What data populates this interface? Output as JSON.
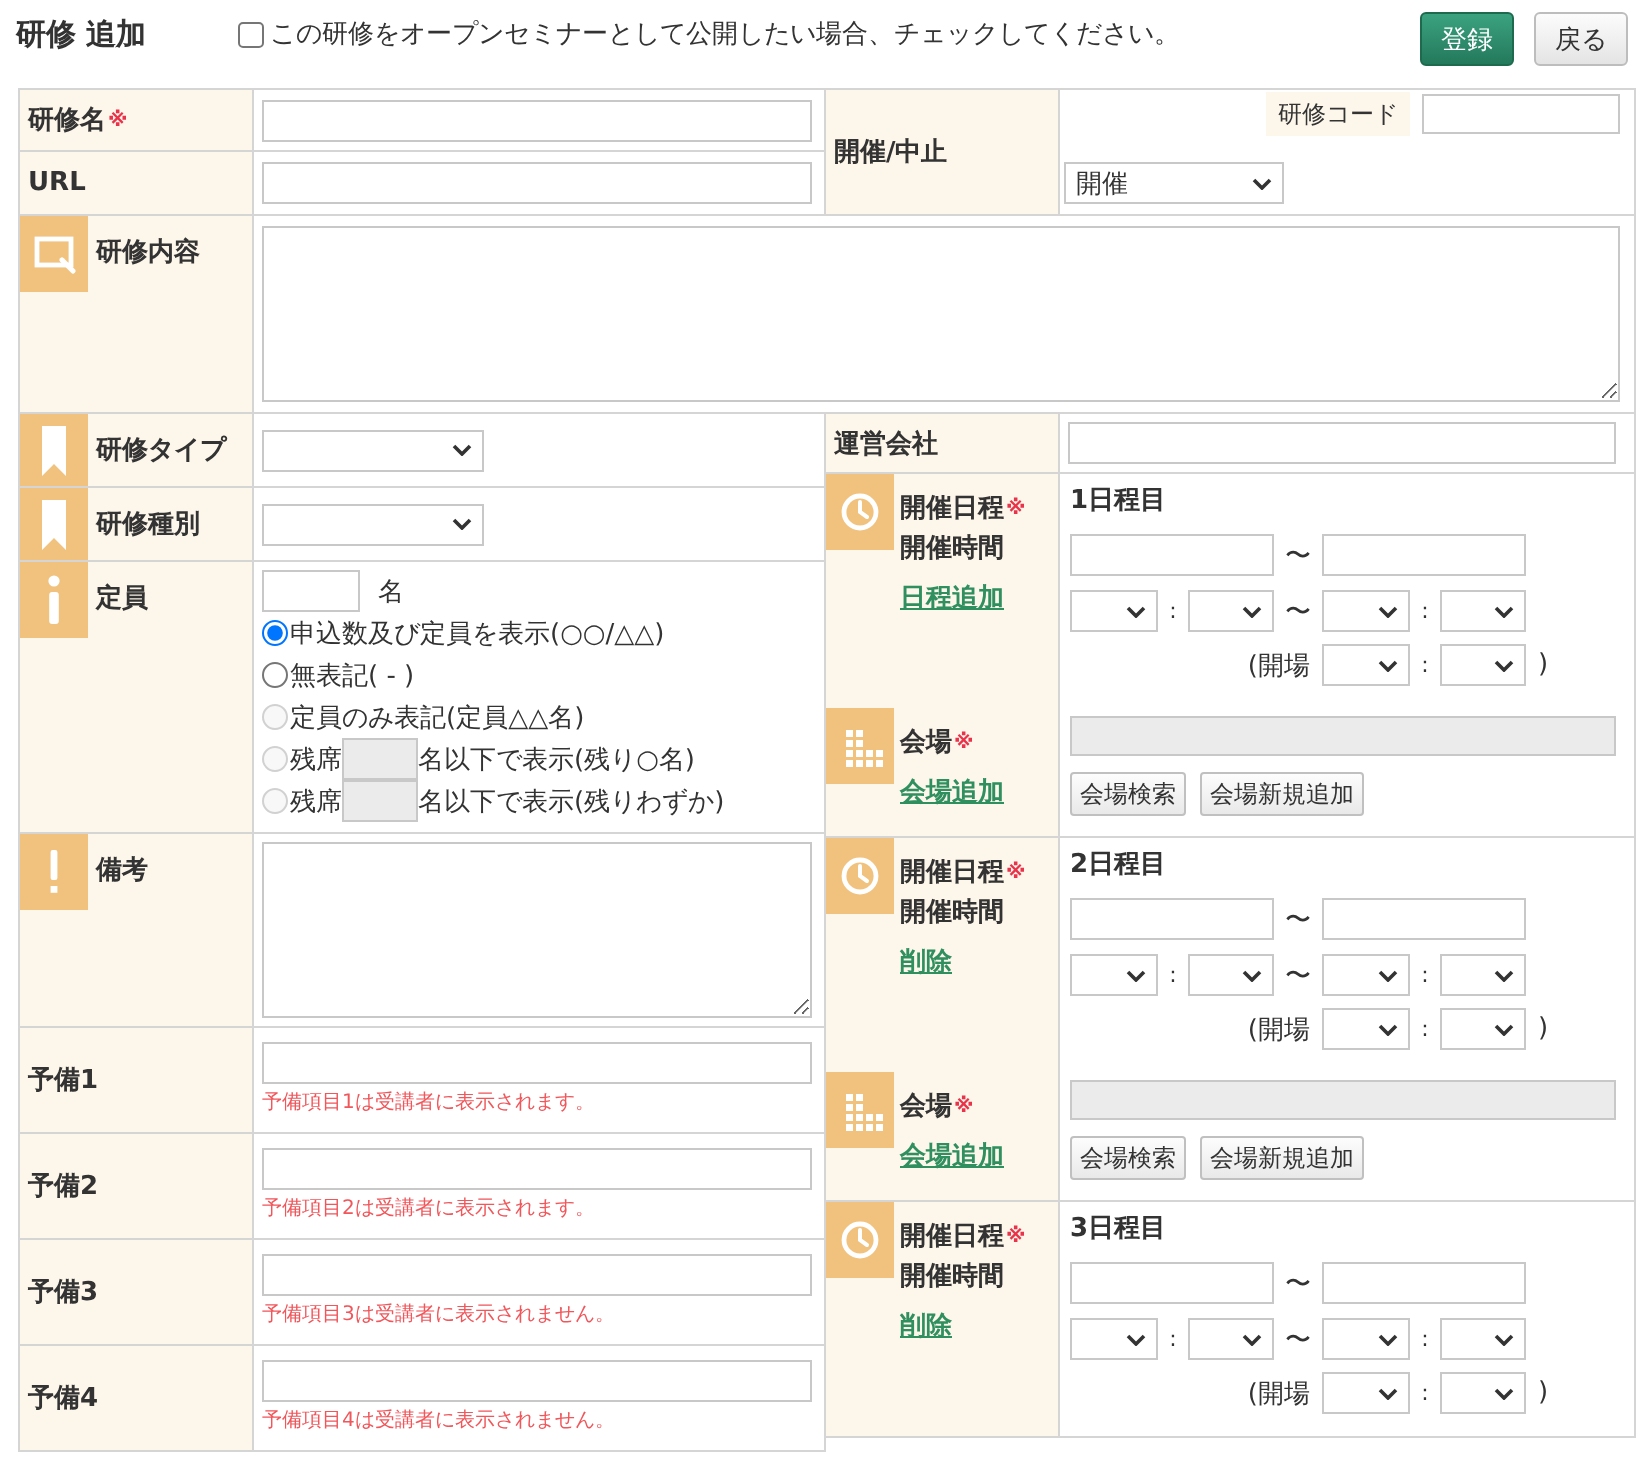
{
  "header": {
    "title": "研修 追加",
    "open_seminar": {
      "label": "この研修をオープンセミナーとして公開したい場合、チェックしてください。",
      "checked": false
    },
    "buttons": [
      {
        "kind": "primary",
        "label": "登録"
      },
      {
        "kind": "secondary",
        "label": "戻る"
      }
    ]
  },
  "basic": {
    "fields": [
      {
        "label": "研修名",
        "required_mark": "※"
      },
      {
        "label": "URL"
      }
    ],
    "status": {
      "label": "開催/中止",
      "code_label": "研修コード",
      "select_value": "開催"
    },
    "content": {
      "label": "研修内容"
    }
  },
  "left_rows": [
    {
      "kind": "select",
      "label": "研修タイプ"
    },
    {
      "kind": "select",
      "label": "研修種別"
    },
    {
      "kind": "capacity",
      "label": "定員",
      "unit": "名",
      "options": [
        {
          "kind": "plain",
          "label": "申込数及び定員を表示(○○/△△)",
          "selected": true,
          "disabled": false
        },
        {
          "kind": "plain",
          "label": "無表記( - )",
          "selected": false,
          "disabled": false
        },
        {
          "kind": "plain",
          "label": "定員のみ表記(定員△△名)",
          "selected": false,
          "disabled": true
        },
        {
          "kind": "threshold",
          "prefix": "残席",
          "suffix": "名以下で表示(残り○名)",
          "selected": false,
          "disabled": true
        },
        {
          "kind": "threshold",
          "prefix": "残席",
          "suffix": "名以下で表示(残りわずか)",
          "selected": false,
          "disabled": true
        }
      ]
    },
    {
      "kind": "remarks",
      "label": "備考"
    },
    {
      "kind": "spare",
      "label": "予備1",
      "note": "予備項目1は受講者に表示されます。"
    },
    {
      "kind": "spare",
      "label": "予備2",
      "note": "予備項目2は受講者に表示されます。"
    },
    {
      "kind": "spare",
      "label": "予備3",
      "note": "予備項目3は受講者に表示されません。"
    },
    {
      "kind": "spare",
      "label": "予備4",
      "note": "予備項目4は受講者に表示されません。"
    }
  ],
  "right": {
    "company": {
      "label": "運営会社"
    },
    "schedules": [
      {
        "label": "開催日程",
        "required_mark": "※",
        "time_label": "開催時間",
        "action": "日程追加",
        "day": "1日程目",
        "date_separator": "〜",
        "start_colon": ":",
        "time_separator": "〜",
        "end_colon": ":",
        "open_label": "(開場",
        "open_colon": ":",
        "open_close": ")",
        "venue": {
          "label": "会場",
          "required_mark": "※",
          "action": "会場追加",
          "disabled": true,
          "buttons": [
            "会場検索",
            "会場新規追加"
          ]
        }
      },
      {
        "label": "開催日程",
        "required_mark": "※",
        "time_label": "開催時間",
        "action": "削除",
        "day": "2日程目",
        "date_separator": "〜",
        "start_colon": ":",
        "time_separator": "〜",
        "end_colon": ":",
        "open_label": "(開場",
        "open_colon": ":",
        "open_close": ")",
        "venue": {
          "label": "会場",
          "required_mark": "※",
          "action": "会場追加",
          "disabled": true,
          "buttons": [
            "会場検索",
            "会場新規追加"
          ]
        }
      },
      {
        "label": "開催日程",
        "required_mark": "※",
        "time_label": "開催時間",
        "action": "削除",
        "day": "3日程目",
        "date_separator": "〜",
        "start_colon": ":",
        "time_separator": "〜",
        "end_colon": ":",
        "open_label": "(開場",
        "open_colon": ":",
        "open_close": ")"
      }
    ]
  }
}
